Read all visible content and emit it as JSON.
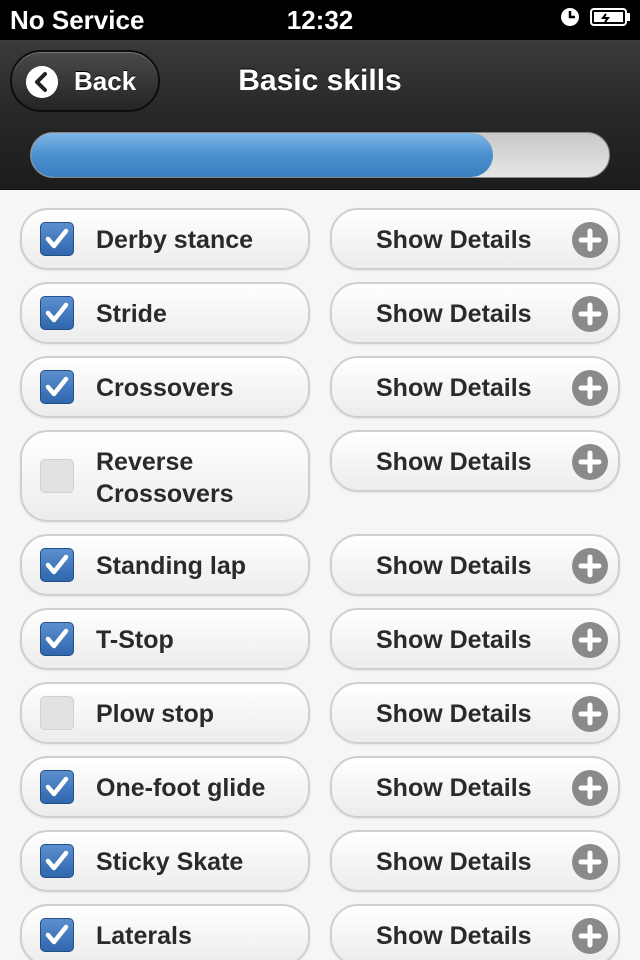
{
  "status_bar": {
    "carrier": "No Service",
    "time": "12:32"
  },
  "header": {
    "back_label": "Back",
    "title": "Basic skills",
    "progress_fraction": 0.8
  },
  "skills": [
    {
      "label": "Derby stance",
      "checked": true,
      "details_label": "Show Details"
    },
    {
      "label": "Stride",
      "checked": true,
      "details_label": "Show Details"
    },
    {
      "label": "Crossovers",
      "checked": true,
      "details_label": "Show Details"
    },
    {
      "label": "Reverse Crossovers",
      "checked": false,
      "details_label": "Show Details"
    },
    {
      "label": "Standing lap",
      "checked": true,
      "details_label": "Show Details"
    },
    {
      "label": "T-Stop",
      "checked": true,
      "details_label": "Show Details"
    },
    {
      "label": "Plow stop",
      "checked": false,
      "details_label": "Show Details"
    },
    {
      "label": "One-foot glide",
      "checked": true,
      "details_label": "Show Details"
    },
    {
      "label": "Sticky Skate",
      "checked": true,
      "details_label": "Show Details"
    },
    {
      "label": "Laterals",
      "checked": true,
      "details_label": "Show Details"
    }
  ],
  "colors": {
    "checkbox_checked": "#2f67ad",
    "progress": "#4a90cf"
  },
  "icons": {
    "back": "chevron-left-icon",
    "details": "plus-circle-icon",
    "clock": "clock-icon",
    "battery": "battery-icon"
  }
}
